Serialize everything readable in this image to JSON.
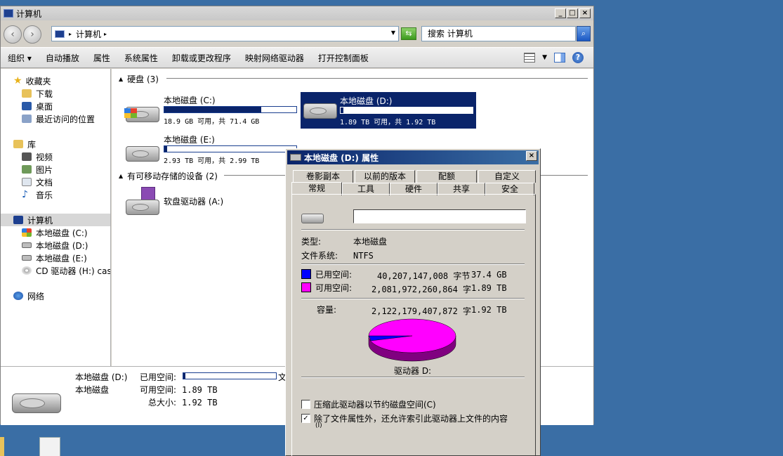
{
  "explorer": {
    "title": "计算机",
    "address": "计算机",
    "search_placeholder": "搜索 计算机",
    "toolbar": [
      "组织 ▾",
      "自动播放",
      "属性",
      "系统属性",
      "卸载或更改程序",
      "映射网络驱动器",
      "打开控制面板"
    ],
    "sidebar": {
      "favorites": "收藏夹",
      "fav_items": [
        "下载",
        "桌面",
        "最近访问的位置"
      ],
      "libraries": "库",
      "lib_items": [
        "视频",
        "图片",
        "文档",
        "音乐"
      ],
      "computer": "计算机",
      "computer_items": [
        "本地磁盘 (C:)",
        "本地磁盘 (D:)",
        "本地磁盘 (E:)",
        "CD 驱动器 (H:) cas"
      ],
      "network": "网络"
    },
    "groups": {
      "hard_disks": "硬盘 (3)",
      "removable": "有可移动存储的设备 (2)"
    },
    "drives": [
      {
        "name": "本地磁盘 (C:)",
        "info": "18.9 GB 可用，共 71.4 GB",
        "used_fraction": 0.735
      },
      {
        "name": "本地磁盘 (D:)",
        "info": "1.89 TB 可用，共 1.92 TB",
        "used_fraction": 0.02
      },
      {
        "name": "本地磁盘 (E:)",
        "info": "2.93 TB 可用，共 2.99 TB",
        "used_fraction": 0.02
      }
    ],
    "floppy": "软盘驱动器 (A:)",
    "details": {
      "name": "本地磁盘 (D:)",
      "type": "本地磁盘",
      "used_label": "已用空间:",
      "free_label": "可用空间:",
      "free_value": "1.89 TB",
      "total_label": "总大小:",
      "total_value": "1.92 TB",
      "cut_text": "文"
    }
  },
  "dialog": {
    "title": "本地磁盘 (D:) 属性",
    "tabs_row1": [
      "卷影副本",
      "以前的版本",
      "配额",
      "自定义"
    ],
    "tabs_row2": [
      "常规",
      "工具",
      "硬件",
      "共享",
      "安全"
    ],
    "type_label": "类型:",
    "type_value": "本地磁盘",
    "fs_label": "文件系统:",
    "fs_value": "NTFS",
    "used_label": "已用空间:",
    "used_bytes": "40,207,147,008 字节",
    "used_size": "37.4 GB",
    "free_label": "可用空间:",
    "free_bytes": "2,081,972,260,864 字",
    "free_size": "1.89 TB",
    "capacity_label": "容量:",
    "capacity_bytes": "2,122,179,407,872 字",
    "capacity_size": "1.92 TB",
    "drive_label": "驱动器 D:",
    "compress_label": "压缩此驱动器以节约磁盘空间(C)",
    "compress_checked": false,
    "index_label": "除了文件属性外，还允许索引此驱动器上文件的内容",
    "index_suffix": "(I)",
    "index_checked": true,
    "colors": {
      "used": "#0000ff",
      "free": "#ff00ff"
    },
    "used_fraction": 0.019
  }
}
